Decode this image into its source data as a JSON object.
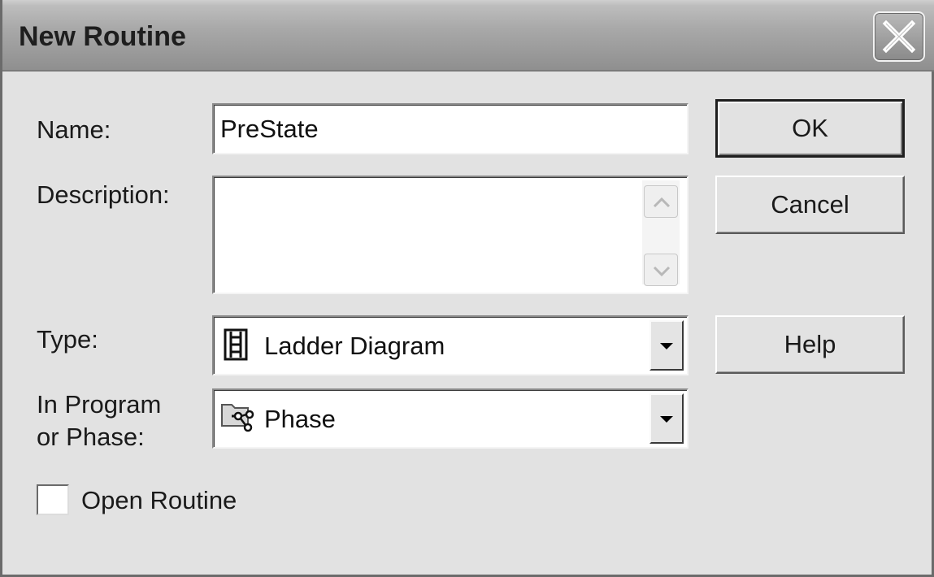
{
  "window": {
    "title": "New Routine",
    "close_icon": "close-icon"
  },
  "form": {
    "name_label": "Name:",
    "name_value": "PreState",
    "description_label": "Description:",
    "description_value": "",
    "type_label": "Type:",
    "type_value": "Ladder Diagram",
    "type_icon": "ladder-diagram-icon",
    "program_label_line1": "In Program",
    "program_label_line2": "or Phase:",
    "program_value": "Phase",
    "program_icon": "phase-folder-icon",
    "open_routine_label": "Open Routine",
    "open_routine_checked": false
  },
  "buttons": {
    "ok": "OK",
    "cancel": "Cancel",
    "help": "Help"
  }
}
